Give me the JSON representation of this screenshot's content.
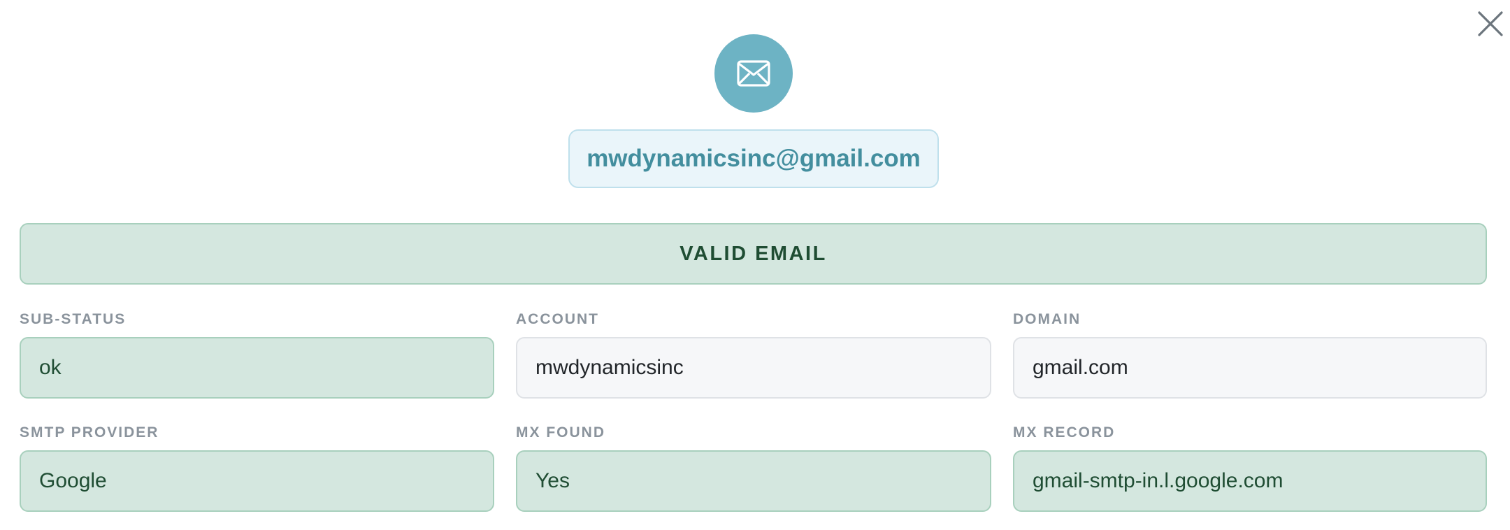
{
  "modal": {
    "close_icon": "close-icon",
    "avatar_icon": "envelope-icon",
    "email": "mwdynamicsinc@gmail.com",
    "status": "VALID EMAIL"
  },
  "colors": {
    "avatar_bg": "#6db3c4",
    "email_text": "#438e9e",
    "email_bg": "#eaf5fa",
    "valid_bg": "#d4e7df",
    "valid_border": "#a8d0bd",
    "valid_text": "#1f4d33",
    "neutral_bg": "#f6f7f9",
    "label_text": "#8a939c"
  },
  "fields": [
    {
      "label": "SUB-STATUS",
      "value": "ok",
      "style": "valid"
    },
    {
      "label": "ACCOUNT",
      "value": "mwdynamicsinc",
      "style": "neutral"
    },
    {
      "label": "DOMAIN",
      "value": "gmail.com",
      "style": "neutral"
    },
    {
      "label": "SMTP PROVIDER",
      "value": "Google",
      "style": "valid"
    },
    {
      "label": "MX FOUND",
      "value": "Yes",
      "style": "valid"
    },
    {
      "label": "MX RECORD",
      "value": "gmail-smtp-in.l.google.com",
      "style": "valid"
    }
  ]
}
